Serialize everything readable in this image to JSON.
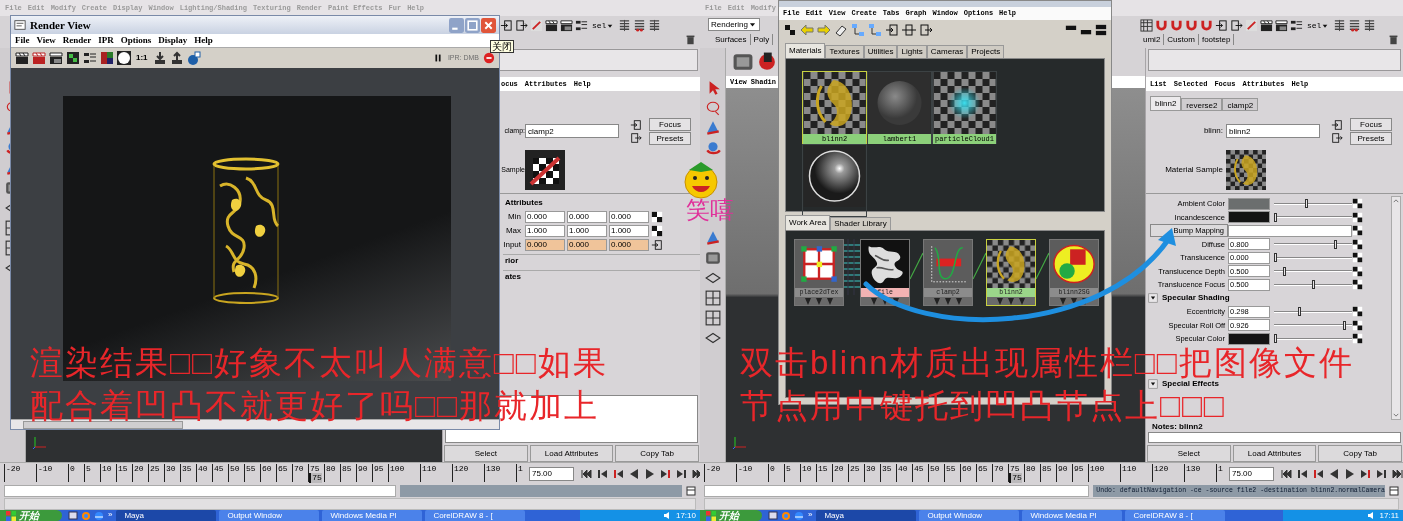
{
  "left_screen": {
    "main_menu": [
      "File",
      "Edit",
      "Modify",
      "Create",
      "Display",
      "Window",
      "Lighting/Shading",
      "Texturing",
      "Render",
      "Paint Effects",
      "Fur",
      "Help"
    ],
    "select_label": "sel",
    "render_view": {
      "title": "Render View",
      "close_tooltip": "关闭",
      "menu": [
        "File",
        "View",
        "Render",
        "IPR",
        "Options",
        "Display",
        "Help"
      ],
      "ratio_label": "1:1",
      "ipr_label": "IPR: DMB"
    },
    "attribute_editor": {
      "menu": [
        "ocus",
        "Attributes",
        "Help"
      ],
      "node_label": "clamp:",
      "node_name": "clamp2",
      "focus_button": "Focus",
      "presets_button": "Presets",
      "sample_label": "Sample",
      "section": "Attributes",
      "rows": [
        {
          "label": "Min",
          "values": [
            "0.000",
            "0.000",
            "0.000"
          ],
          "connected": false
        },
        {
          "label": "Max",
          "values": [
            "1.000",
            "1.000",
            "1.000"
          ],
          "connected": false
        },
        {
          "label": "Input",
          "values": [
            "0.000",
            "0.000",
            "0.000"
          ],
          "connected": true
        }
      ],
      "collapsed_sections": [
        "rior",
        "ates"
      ],
      "buttons": [
        "Select",
        "Load Attributes",
        "Copy Tab"
      ]
    },
    "caption": [
      "渲染结果□□好象不太叫人满意□□如果",
      "配合着凹凸不就更好了吗□□那就加上"
    ],
    "timeline": {
      "labels": [
        "-20",
        "-10",
        "0",
        "5",
        "10",
        "15",
        "20",
        "25",
        "30",
        "35",
        "40",
        "45",
        "50",
        "55",
        "60",
        "65",
        "70",
        "75",
        "80",
        "85",
        "90",
        "95",
        "100",
        "110",
        "120",
        "130",
        "1"
      ],
      "current_frame": "75",
      "level": 0.59,
      "frame_field": "75.00"
    },
    "taskbar": {
      "start": "开始",
      "more": "»",
      "tasks": [
        {
          "label": "Maya",
          "selected": true
        },
        {
          "label": "Output Window",
          "selected": false
        },
        {
          "label": "Windows Media Pl",
          "selected": false
        },
        {
          "label": "CorelDRAW 8 - [",
          "selected": false
        }
      ],
      "clock": "17:10"
    }
  },
  "sticker": {
    "text": "笑嘻"
  },
  "right_screen": {
    "main_menu": [
      "File",
      "Edit",
      "Modify"
    ],
    "menu_set": "Rendering",
    "shelf_tabs_left": [
      "Surfaces",
      "Poly"
    ],
    "shelf_tabs_right": [
      "umi2",
      "Custom",
      "footstep"
    ],
    "select_label": "sel",
    "panel_menu": [
      "View",
      "Shadin"
    ],
    "hypershade": {
      "menu": [
        "File",
        "Edit",
        "View",
        "Create",
        "Tabs",
        "Graph",
        "Window",
        "Options",
        "Help"
      ],
      "tabs": [
        {
          "label": "Materials",
          "selected": true
        },
        {
          "label": "Textures",
          "selected": false
        },
        {
          "label": "Utilities",
          "selected": false
        },
        {
          "label": "Lights",
          "selected": false
        },
        {
          "label": "Cameras",
          "selected": false
        },
        {
          "label": "Projects",
          "selected": false
        }
      ],
      "swatches": [
        {
          "kind": "checker_gold",
          "label": "blinn2",
          "selected": true
        },
        {
          "kind": "gray_sphere",
          "label": "lambert1",
          "selected": false
        },
        {
          "kind": "checker_cyan",
          "label": "particleCloud1",
          "selected": false
        },
        {
          "kind": "chrome_sphere",
          "selected": false
        }
      ],
      "work_tabs": [
        {
          "label": "Work Area",
          "selected": true
        },
        {
          "label": "Shader Library",
          "selected": false
        }
      ],
      "nodes": [
        {
          "kind": "place2d",
          "label": "place2dTex",
          "color": "#8c8c8c"
        },
        {
          "kind": "file",
          "label": "file",
          "color": "#f2b3b3"
        },
        {
          "kind": "clamp",
          "label": "clamp2",
          "color": "#8c8c8c"
        },
        {
          "kind": "checker_gold",
          "label": "blinn2",
          "color": "#9bd68a"
        },
        {
          "kind": "shading_group",
          "label": "blinn2SG",
          "color": "#8c8c8c"
        }
      ]
    },
    "attribute_editor": {
      "menu": [
        "List",
        "Selected",
        "Focus",
        "Attributes",
        "Help"
      ],
      "tabs": [
        {
          "label": "blinn2",
          "selected": true
        },
        {
          "label": "reverse2",
          "selected": false
        },
        {
          "label": "clamp2",
          "selected": false
        }
      ],
      "node_label": "blinn:",
      "node_name": "blinn2",
      "focus_button": "Focus",
      "presets_button": "Presets",
      "sample_label": "Material Sample",
      "rows": [
        {
          "kind": "color",
          "label": "Ambient Color",
          "color": "#6b6e6e",
          "level": 0.42
        },
        {
          "kind": "color",
          "label": "Incandescence",
          "color": "#141414",
          "level": 0
        },
        {
          "kind": "map",
          "label": "Bump Mapping"
        },
        {
          "kind": "number",
          "label": "Diffuse",
          "value": "0.800",
          "level": 0.8
        },
        {
          "kind": "number",
          "label": "Translucence",
          "value": "0.000",
          "level": 0
        },
        {
          "kind": "number",
          "label": "Translucence Depth",
          "value": "0.500",
          "level": 0.12
        },
        {
          "kind": "number",
          "label": "Translucence Focus",
          "value": "0.500",
          "level": 0.5
        },
        {
          "kind": "section",
          "label": "Specular Shading"
        },
        {
          "kind": "number",
          "label": "Eccentricity",
          "value": "0.298",
          "level": 0.32
        },
        {
          "kind": "number",
          "label": "Specular Roll Off",
          "value": "0.926",
          "level": 0.92
        },
        {
          "kind": "color",
          "label": "Specular Color",
          "color": "#141414",
          "level": 0
        },
        {
          "kind": "section",
          "label": "Special Effects"
        }
      ],
      "notes_label": "Notes: blinn2",
      "buttons": [
        "Select",
        "Load Attributes",
        "Copy Tab"
      ]
    },
    "caption": [
      "双击blinn材质出现属性栏□□把图像文件",
      "节点用中键托到凹凸节点上□□□"
    ],
    "timeline": {
      "labels": [
        "-20",
        "-10",
        "0",
        "5",
        "10",
        "15",
        "20",
        "25",
        "30",
        "35",
        "40",
        "45",
        "50",
        "55",
        "60",
        "65",
        "70",
        "75",
        "80",
        "85",
        "90",
        "95",
        "100",
        "110",
        "120",
        "130",
        "1"
      ],
      "current_frame": "75",
      "level": 0.59,
      "frame_field": "75.00"
    },
    "command_response": "Undo: defaultNavigation -ce -source file2 -destination blinn2.normalCamera",
    "taskbar": {
      "start": "开始",
      "more": "»",
      "tasks": [
        {
          "label": "Maya",
          "selected": true
        },
        {
          "label": "Output Window",
          "selected": false
        },
        {
          "label": "Windows Media Pl",
          "selected": false
        },
        {
          "label": "CorelDRAW 8 - [",
          "selected": false
        }
      ],
      "clock": "17:11"
    }
  }
}
